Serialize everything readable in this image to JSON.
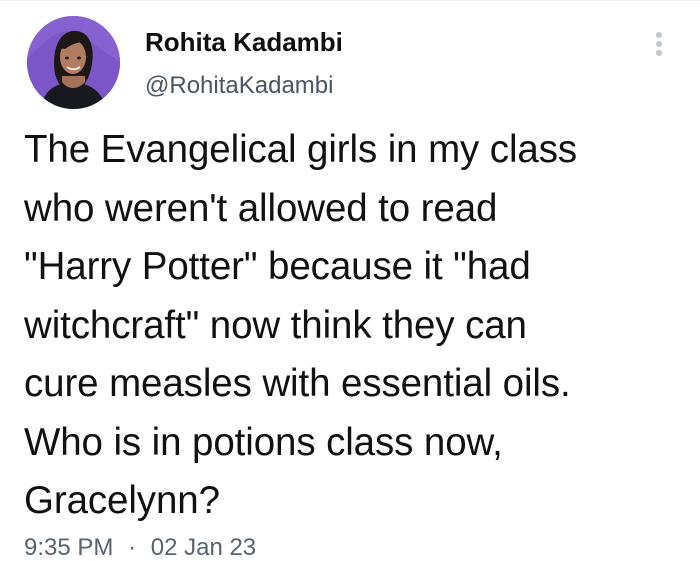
{
  "tweet": {
    "author": {
      "display_name": "Rohita Kadambi",
      "handle": "@RohitaKadambi",
      "avatar_icon": "profile-photo"
    },
    "more_icon": "more-vertical-icon",
    "text": "The Evangelical girls in my class\nwho weren't allowed to read\n\"Harry Potter\" because it \"had\nwitchcraft\" now think they can\ncure measles with essential oils.\nWho is in potions class now,\nGracelynn?",
    "time": "9:35 PM",
    "separator": "·",
    "date": "02 Jan 23"
  },
  "colors": {
    "avatar_background": "#7c55c7",
    "text": "#111111",
    "secondary_text": "#59636e"
  }
}
